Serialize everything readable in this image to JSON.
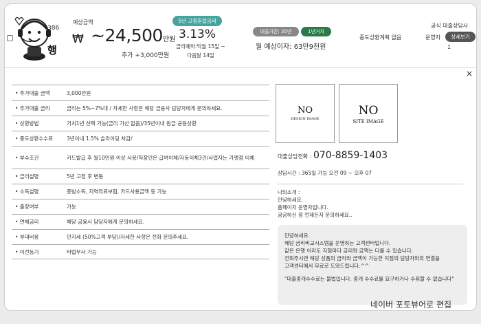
{
  "header": {
    "mascot_number": "386",
    "mascot_char": "행",
    "monthly_label": "예상금액",
    "currency_symbol": "₩",
    "amount": "~24,500",
    "amount_unit": "만원",
    "extra_loan": "추가 +3,000만원",
    "fixed_rate_label": "5년 고정혼합금리",
    "rate": "3.13%",
    "rate_date_line1": "금리예약:익월 15일 ~",
    "rate_date_line2": "다음달 14일",
    "term_pill": "대출기간: 35년",
    "fixed_period_pill": "1년거치",
    "monthly_interest": "월 예상이자: 63만9천원",
    "prepay": "중도상환계획 없음",
    "official": "공식 대출상담사",
    "operator": "운영자",
    "detail_button": "상세보기",
    "count": "1"
  },
  "close_symbol": "×",
  "details": [
    {
      "label": "• 추가대출 금액",
      "value": "3,000만원"
    },
    {
      "label": "• 추가대출 금리",
      "value": "금리는 5%~7%대 / 자세한 사항은 해당 금융사 담당자에게 문의하세요."
    },
    {
      "label": "• 상환방법",
      "value": "거치1년 선택 가능(금리 가산 없음)/35년이내 원금 균등상환"
    },
    {
      "label": "• 중도상환수수료",
      "value": "3년이내 1.5% 슬라이딩 차감/"
    },
    {
      "label": "• 부수조건",
      "value": "카드발급 후 월10만원 이상 사용/직장인은 급여이체/자동이체3건/사업자는 가맹점 이체"
    },
    {
      "label": "• 금리설명",
      "value": "5년 고정 후 변동"
    },
    {
      "label": "• 소득설명",
      "value": "증빙소득, 지역의료보험, 카드사용금액 등 가능"
    },
    {
      "label": "• 출장여부",
      "value": "가능"
    },
    {
      "label": "• 연체금리",
      "value": "해당 금융사 담당자에게 문의하세요."
    },
    {
      "label": "• 부대비용",
      "value": "인지세 (50%고객 부담)/자세한 사항은 전화 문의주세요."
    },
    {
      "label": "• 이전등기",
      "value": "타법무사 가능"
    }
  ],
  "image1": {
    "big": "NO",
    "small": "DESIGN IMAGE"
  },
  "image2": {
    "big": "NO",
    "small": "SITE IMAGE"
  },
  "phone_label": "대출상담전화 : ",
  "phone": "070-8859-1403",
  "hours": "상담시간 : 365일 가능 오전 09 ~ 오후 07",
  "intro": {
    "title": "나의소개 :",
    "lines": [
      "안녕하세요.",
      "홈페이지 운영자입니다.",
      "궁금하신 점 언제든지 문의하세요.."
    ]
  },
  "notice": {
    "lines": [
      "안녕하세요.",
      "해당 금리비교시스템을 운영하는 고객센터입니다.",
      "같은 은행 이라도 지점마다 금리와 금액는 다를 수 있습니다.",
      "전화주시면 해당 상품의 금리와 금액이 가능한 지점의 담당자와의 연결을",
      "고객센터에서 무료로 도와드립니다.^^"
    ],
    "warning": "\"대출중개수수료는 불법입니다. 중개 수수료를 요구하거나 수취할 수 없습니다\""
  },
  "watermark": "네이버 포토뷰어로 편집"
}
